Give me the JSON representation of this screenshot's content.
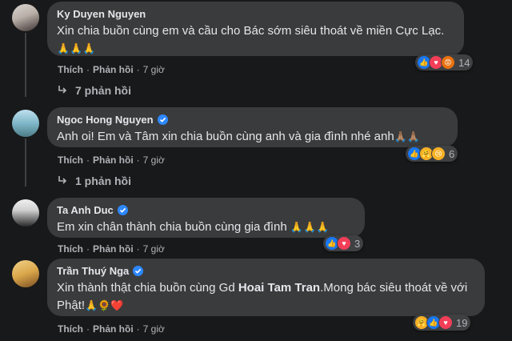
{
  "comments": [
    {
      "name": "Ky Duyen Nguyen",
      "verified": false,
      "text": "Xin chia buồn cùng em và cầu cho Bác sớm siêu thoát về miền Cực Lạc.",
      "emoji": "🙏🙏🙏",
      "reactions": [
        "like-icon",
        "love-icon",
        "angry-icon"
      ],
      "reaction_count": "14",
      "like_label": "Thích",
      "reply_label": "Phản hồi",
      "time": "7 giờ",
      "replies_label": "7 phản hồi"
    },
    {
      "name": "Ngoc Hong Nguyen",
      "verified": true,
      "text": "Anh oi! Em và Tâm xin chia buồn cùng anh và gia đình nhé anh",
      "emoji": "🙏🏽🙏🏽",
      "reactions": [
        "like-icon",
        "care-icon",
        "sad-icon"
      ],
      "reaction_count": "6",
      "like_label": "Thích",
      "reply_label": "Phản hồi",
      "time": "7 giờ",
      "replies_label": "1 phản hồi"
    },
    {
      "name": "Ta Anh Duc",
      "verified": true,
      "text": "Em xin chân thành chia buồn cùng gia đình",
      "emoji": "🙏🙏🙏",
      "reactions": [
        "like-icon",
        "love-icon"
      ],
      "reaction_count": "3",
      "like_label": "Thích",
      "reply_label": "Phản hồi",
      "time": "7 giờ"
    },
    {
      "name": "Trần Thuý Nga",
      "verified": true,
      "text_before": "Xin thành thật chia buồn cùng Gd ",
      "mention": "Hoai Tam Tran",
      "text_after": ".Mong bác siêu thoát về với Phật!",
      "emoji": "🙏🌻❤️",
      "reactions": [
        "care-icon",
        "like-icon",
        "love-icon"
      ],
      "reaction_count": "19",
      "like_label": "Thích",
      "reply_label": "Phản hồi",
      "time": "7 giờ"
    }
  ],
  "colors": {
    "background": "#18191a",
    "bubble": "#3a3b3c",
    "text": "#e4e6eb",
    "muted": "#b0b3b8",
    "verified": "#2d88ff"
  }
}
